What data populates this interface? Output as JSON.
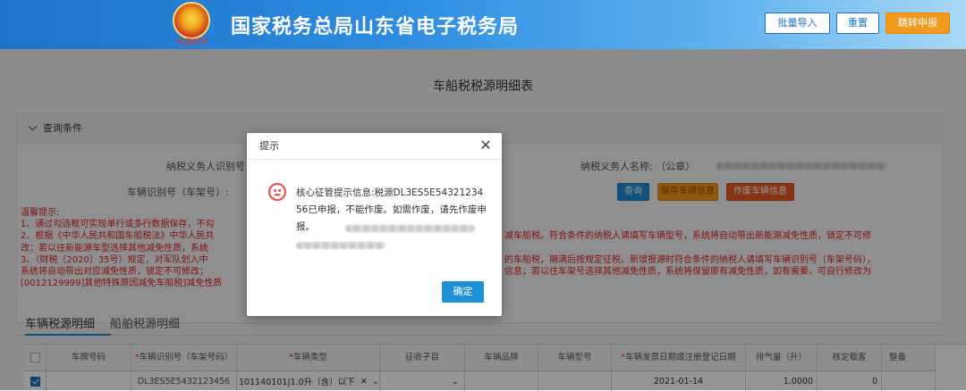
{
  "header": {
    "title": "国家税务总局山东省电子税务局",
    "emblem_text": "中国税务",
    "buttons": {
      "batch_import": "批量导入",
      "reset": "重置",
      "jump_declare": "跳转申报"
    }
  },
  "page_title": "车船税税源明细表",
  "query": {
    "section_title": "查询条件",
    "taxpayer_id_label": "纳税义务人识别号",
    "taxpayer_name_label": "纳税义务人名称: （公章）",
    "vehicle_id_label": "车辆识别号（车架号）:",
    "buttons": {
      "search": "查询",
      "save_vehicle": "保存车辆信息",
      "void_vehicle": "作废车辆信息"
    },
    "warning": {
      "title": "温馨提示:",
      "line1": "1、通过勾选框可实现单行或多行数据保存，不勾",
      "line2a": "2、根据《中华人民共和国车船税法》中华人民共",
      "line2b": "减车船税。符合条件的纳税人请填写车辆型号，系统将自动带出新能源减免性质，锁定不可修",
      "line3a": "改；若以往新能源车型选择其他减免性质，系统",
      "line4a": "3、（财税〔2020〕35号）规定，对军队划入中",
      "line4b": "的车船税，期满后按规定征税。新增报源时符合条件的纳税人请填写车辆识别号（车架号码），",
      "line5a": "系统将自动带出对应减免性质，锁定不可修改；",
      "line5b": "信息；若以往车架号选择其他减免性质，系统将保留原有减免性质，如有需要，可自行修改为",
      "line6a": "[0012129999]其他特殊原因减免车船税]减免性质"
    }
  },
  "tabs": [
    {
      "label": "车辆税源明细"
    },
    {
      "label": "船舶税源明细"
    }
  ],
  "table": {
    "headers": [
      "车牌号码",
      "车辆识别号（车架号码）",
      "车辆类型",
      "征收子目",
      "车辆品牌",
      "车辆型号",
      "车辆发票日期或注册登记日期",
      "排气量（升）",
      "核定载客",
      "整备"
    ],
    "row": {
      "vin": "DL3ES5E5432123456",
      "vehicle_type": "101140101|1.0升（含）以下",
      "date": "2021-01-14",
      "displacement": "1.0000",
      "capacity": "0"
    }
  },
  "modal": {
    "title": "提示",
    "message": "核心征管提示信息:税源DL3ES5E5432123456已申报，不能作废。如需作废，请先作废申报。",
    "ok_label": "确定"
  },
  "colors": {
    "brand": "#1e73c9",
    "accent_orange": "#f29a1d",
    "danger": "#e84a4a",
    "primary_button": "#1e90d6"
  }
}
